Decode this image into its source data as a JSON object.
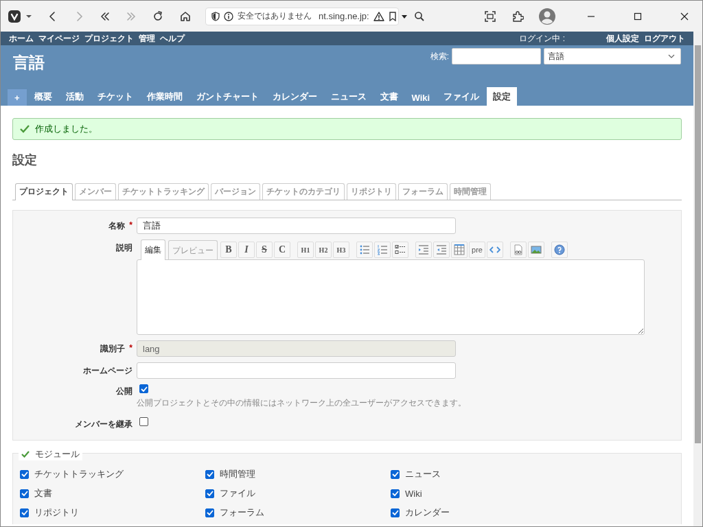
{
  "browser": {
    "security": "安全ではありません",
    "url": "nt.sing.ne.jp:"
  },
  "top_menu": {
    "items": [
      "ホーム",
      "マイページ",
      "プロジェクト",
      "管理",
      "ヘルプ"
    ],
    "login": "ログイン中 :",
    "account_items": [
      "個人設定",
      "ログアウト"
    ]
  },
  "header": {
    "title": "言語",
    "search_label": "検索:",
    "project_select": "言語"
  },
  "main_tabs": [
    {
      "kind": "new",
      "label": "+",
      "selected": false
    },
    {
      "kind": "tab",
      "label": "概要",
      "selected": false
    },
    {
      "kind": "tab",
      "label": "活動",
      "selected": false
    },
    {
      "kind": "tab",
      "label": "チケット",
      "selected": false
    },
    {
      "kind": "tab",
      "label": "作業時間",
      "selected": false
    },
    {
      "kind": "tab",
      "label": "ガントチャート",
      "selected": false
    },
    {
      "kind": "tab",
      "label": "カレンダー",
      "selected": false
    },
    {
      "kind": "tab",
      "label": "ニュース",
      "selected": false
    },
    {
      "kind": "tab",
      "label": "文書",
      "selected": false
    },
    {
      "kind": "tab",
      "label": "Wiki",
      "selected": false
    },
    {
      "kind": "tab",
      "label": "ファイル",
      "selected": false
    },
    {
      "kind": "tab",
      "label": "設定",
      "selected": true
    }
  ],
  "flash": "作成しました。",
  "heading": "設定",
  "settings_tabs": [
    {
      "label": "プロジェクト",
      "selected": true
    },
    {
      "label": "メンバー",
      "selected": false
    },
    {
      "label": "チケットトラッキング",
      "selected": false
    },
    {
      "label": "バージョン",
      "selected": false
    },
    {
      "label": "チケットのカテゴリ",
      "selected": false
    },
    {
      "label": "リポジトリ",
      "selected": false
    },
    {
      "label": "フォーラム",
      "selected": false
    },
    {
      "label": "時間管理",
      "selected": false
    }
  ],
  "form": [
    {
      "kind": "text",
      "label": "名称",
      "required_mark": "*",
      "value": "言語",
      "disabled": false
    },
    {
      "kind": "editor",
      "label": "説明"
    },
    {
      "kind": "text",
      "label": "識別子",
      "required_mark": "*",
      "value": "lang",
      "disabled": true
    },
    {
      "kind": "text",
      "label": "ホームページ",
      "disabled": false
    },
    {
      "kind": "checkbox",
      "label": "公開",
      "checked": true,
      "hint": "公開プロジェクトとその中の情報にはネットワーク上の全ユーザーがアクセスできます。"
    },
    {
      "kind": "checkbox",
      "label": "メンバーを継承",
      "checked": false
    }
  ],
  "editor": {
    "tabs": [
      {
        "label": "編集",
        "selected": true
      },
      {
        "label": "プレビュー",
        "selected": false
      }
    ],
    "toolbar": [
      [
        {
          "kind": "bold",
          "label": "B"
        },
        {
          "kind": "italic",
          "label": "I"
        },
        {
          "kind": "strike",
          "label": "S"
        },
        {
          "kind": "code",
          "label": "C"
        }
      ],
      [
        {
          "kind": "heading",
          "label": "H1"
        },
        {
          "kind": "heading",
          "label": "H2"
        },
        {
          "kind": "heading",
          "label": "H3"
        }
      ],
      [
        {
          "kind": "ul"
        },
        {
          "kind": "ol"
        },
        {
          "kind": "tasks"
        }
      ],
      [
        {
          "kind": "indent"
        },
        {
          "kind": "outdent"
        },
        {
          "kind": "table"
        },
        {
          "kind": "pre",
          "label": "pre"
        },
        {
          "kind": "inline"
        }
      ],
      [
        {
          "kind": "link"
        },
        {
          "kind": "image"
        }
      ],
      [
        {
          "kind": "help"
        }
      ]
    ]
  },
  "modules": {
    "legend": "モジュール",
    "items": [
      {
        "label": "チケットトラッキング",
        "checked": true
      },
      {
        "label": "時間管理",
        "checked": true
      },
      {
        "label": "ニュース",
        "checked": true
      },
      {
        "label": "文書",
        "checked": true
      },
      {
        "label": "ファイル",
        "checked": true
      },
      {
        "label": "Wiki",
        "checked": true
      },
      {
        "label": "リポジトリ",
        "checked": true
      },
      {
        "label": "フォーラム",
        "checked": true
      },
      {
        "label": "カレンダー",
        "checked": true
      }
    ]
  }
}
